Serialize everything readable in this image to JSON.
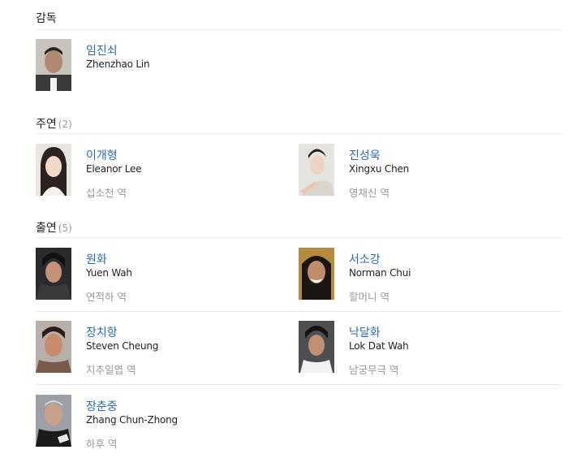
{
  "director": {
    "title": "감독",
    "people": [
      {
        "korean_name": "임진쇠",
        "english_name": "Zhenzhao Lin"
      }
    ]
  },
  "lead": {
    "title": "주연",
    "count": "(2)",
    "people": [
      {
        "korean_name": "이개형",
        "english_name": "Eleanor Lee",
        "role": "섭소천 역"
      },
      {
        "korean_name": "진성욱",
        "english_name": "Xingxu Chen",
        "role": "영채신 역"
      }
    ]
  },
  "support": {
    "title": "출연",
    "count": "(5)",
    "people": [
      {
        "korean_name": "원화",
        "english_name": "Yuen Wah",
        "role": "연적하 역"
      },
      {
        "korean_name": "서소강",
        "english_name": "Norman Chui",
        "role": "할머니 역"
      },
      {
        "korean_name": "장치항",
        "english_name": "Steven Cheung",
        "role": "지추일엽 역"
      },
      {
        "korean_name": "낙달화",
        "english_name": "Lok Dat Wah",
        "role": "남궁무극 역"
      },
      {
        "korean_name": "장춘중",
        "english_name": "Zhang Chun-Zhong",
        "role": "하후 역"
      }
    ]
  }
}
